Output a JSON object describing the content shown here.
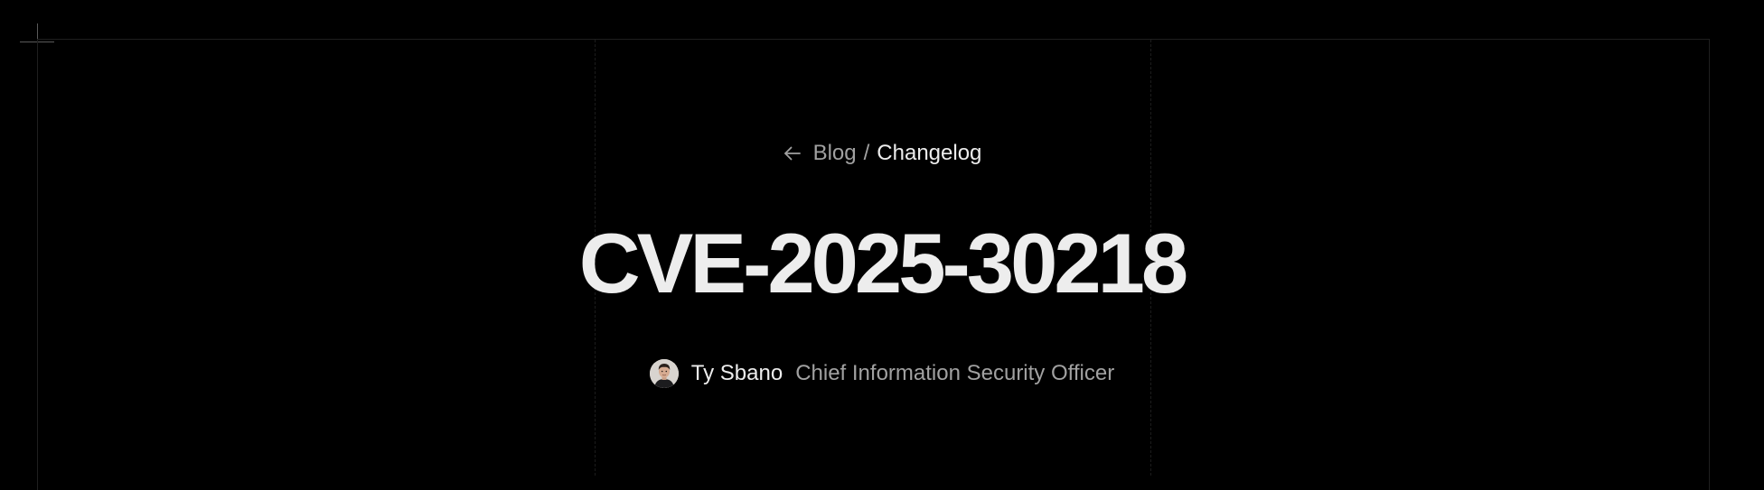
{
  "breadcrumb": {
    "back_icon": "arrow-left-icon",
    "parent": "Blog",
    "separator": "/",
    "current": "Changelog"
  },
  "post": {
    "title": "CVE-2025-30218"
  },
  "author": {
    "avatar_icon": "avatar",
    "name": "Ty Sbano",
    "role": "Chief Information Security Officer"
  },
  "colors": {
    "background": "#000000",
    "text_primary": "#ededed",
    "text_secondary": "#a1a1a1",
    "grid_line": "#1f1f1f"
  }
}
